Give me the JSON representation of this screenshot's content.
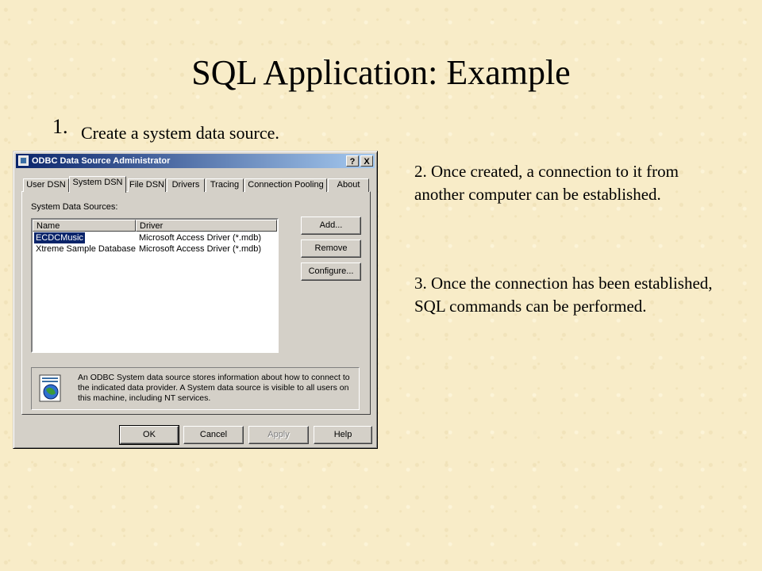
{
  "slide": {
    "title": "SQL Application: Example",
    "step1_number": "1.",
    "step1_text": "Create a system data source.",
    "step2": "2. Once created, a connection to it from another computer can be established.",
    "step3": "3. Once the connection has been established, SQL commands can be performed."
  },
  "dialog": {
    "title": "ODBC Data Source Administrator",
    "help_btn": "?",
    "close_btn": "X",
    "tabs": [
      "User DSN",
      "System DSN",
      "File DSN",
      "Drivers",
      "Tracing",
      "Connection Pooling",
      "About"
    ],
    "active_tab": "System DSN",
    "list_label": "System Data Sources:",
    "columns": [
      "Name",
      "Driver"
    ],
    "rows": [
      {
        "name": "ECDCMusic",
        "driver": "Microsoft Access Driver (*.mdb)",
        "selected": true
      },
      {
        "name": "Xtreme Sample Database",
        "driver": "Microsoft Access Driver (*.mdb)",
        "selected": false
      }
    ],
    "buttons": {
      "add": "Add...",
      "remove": "Remove",
      "configure": "Configure...",
      "ok": "OK",
      "cancel": "Cancel",
      "apply": "Apply",
      "help": "Help"
    },
    "info_text": "An ODBC System data source stores information about how to connect to the indicated data provider.  A System data source is visible to all users on this machine, including NT services."
  },
  "colors": {
    "background": "#f8ecc8",
    "titlebar_start": "#0a246a",
    "titlebar_end": "#a6caf0",
    "dialog_face": "#d4d0c8"
  }
}
